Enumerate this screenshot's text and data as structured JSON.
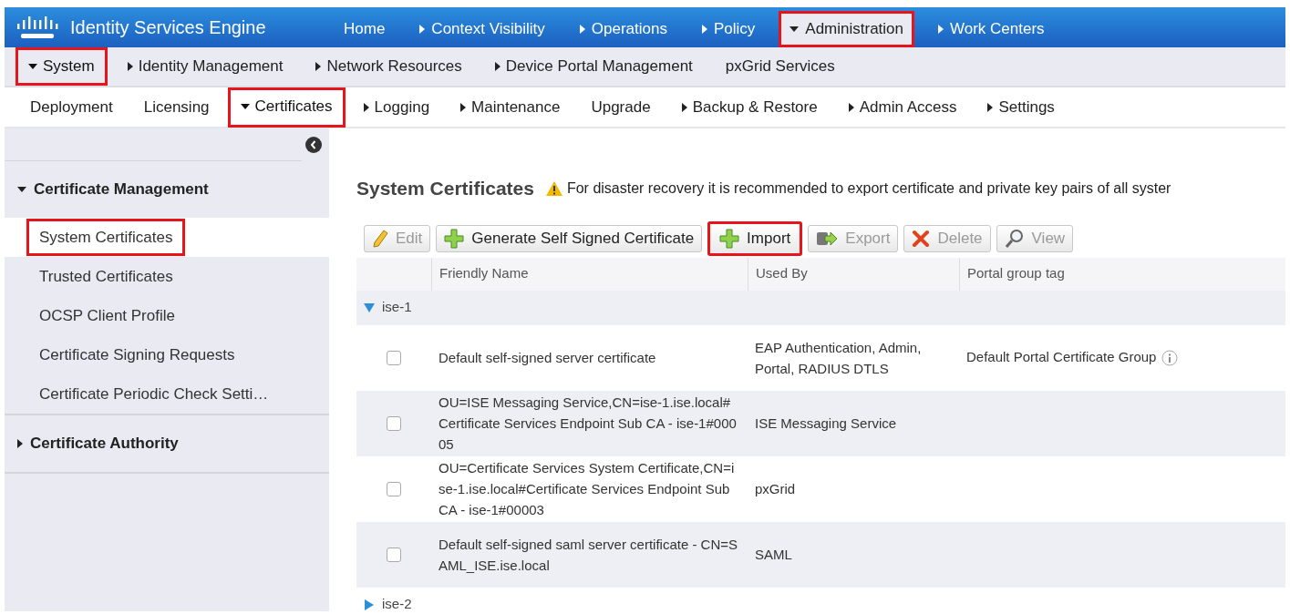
{
  "app": {
    "title": "Identity Services Engine"
  },
  "top_nav": [
    {
      "label": "Home",
      "selected": false,
      "highlighted": false
    },
    {
      "label": "Context Visibility",
      "expanded": false,
      "selected": false,
      "highlighted": false
    },
    {
      "label": "Operations",
      "expanded": false,
      "selected": false,
      "highlighted": false
    },
    {
      "label": "Policy",
      "expanded": false,
      "selected": false,
      "highlighted": false
    },
    {
      "label": "Administration",
      "expanded": true,
      "selected": true,
      "highlighted": true
    },
    {
      "label": "Work Centers",
      "expanded": false,
      "selected": false,
      "highlighted": false
    }
  ],
  "second_nav": [
    {
      "label": "System",
      "expanded": true,
      "selected": true,
      "highlighted": true
    },
    {
      "label": "Identity Management",
      "expanded": false,
      "selected": false,
      "highlighted": false
    },
    {
      "label": "Network Resources",
      "expanded": false,
      "selected": false,
      "highlighted": false
    },
    {
      "label": "Device Portal Management",
      "expanded": false,
      "selected": false,
      "highlighted": false
    },
    {
      "label": "pxGrid Services",
      "selected": false,
      "highlighted": false
    }
  ],
  "third_nav": [
    {
      "label": "Deployment",
      "selected": false,
      "highlighted": false
    },
    {
      "label": "Licensing",
      "selected": false,
      "highlighted": false
    },
    {
      "label": "Certificates",
      "expanded": true,
      "selected": true,
      "highlighted": true
    },
    {
      "label": "Logging",
      "expanded": false,
      "selected": false,
      "highlighted": false
    },
    {
      "label": "Maintenance",
      "expanded": false,
      "selected": false,
      "highlighted": false
    },
    {
      "label": "Upgrade",
      "selected": false,
      "highlighted": false
    },
    {
      "label": "Backup & Restore",
      "expanded": false,
      "selected": false,
      "highlighted": false
    },
    {
      "label": "Admin Access",
      "expanded": false,
      "selected": false,
      "highlighted": false
    },
    {
      "label": "Settings",
      "expanded": false,
      "selected": false,
      "highlighted": false
    }
  ],
  "sidebar": {
    "sections": [
      {
        "label": "Certificate Management",
        "expanded": true,
        "items": [
          {
            "label": "System Certificates",
            "selected": true,
            "highlighted": true
          },
          {
            "label": "Trusted Certificates",
            "selected": false,
            "highlighted": false
          },
          {
            "label": "OCSP Client Profile",
            "selected": false,
            "highlighted": false
          },
          {
            "label": "Certificate Signing Requests",
            "selected": false,
            "highlighted": false
          },
          {
            "label": "Certificate Periodic Check Setti…",
            "selected": false,
            "highlighted": false
          }
        ]
      },
      {
        "label": "Certificate Authority",
        "expanded": false
      }
    ]
  },
  "page": {
    "title": "System Certificates",
    "warning": "For disaster recovery it is recommended to export certificate and private key pairs of all syster"
  },
  "toolbar": [
    {
      "label": "Edit",
      "kind": "edit",
      "disabled": true,
      "highlighted": false
    },
    {
      "label": "Generate Self Signed Certificate",
      "kind": "add",
      "disabled": false,
      "highlighted": false
    },
    {
      "label": "Import",
      "kind": "add",
      "disabled": false,
      "highlighted": true
    },
    {
      "label": "Export",
      "kind": "export",
      "disabled": true,
      "highlighted": false
    },
    {
      "label": "Delete",
      "kind": "delete",
      "disabled": true,
      "highlighted": false
    },
    {
      "label": "View",
      "kind": "view",
      "disabled": true,
      "highlighted": false
    }
  ],
  "table": {
    "columns": [
      "Friendly Name",
      "Used By",
      "Portal group tag"
    ],
    "groups": [
      {
        "label": "ise-1",
        "expanded": true,
        "rows": [
          {
            "checked": false,
            "friendly_name": "Default self-signed server certificate",
            "used_by": "EAP Authentication, Admin, Portal, RADIUS DTLS",
            "portal_group_tag": "Default Portal Certificate Group",
            "info": true
          },
          {
            "checked": false,
            "friendly_name": "OU=ISE Messaging Service,CN=ise-1.ise.local#Certificate Services Endpoint Sub CA - ise-1#00005",
            "used_by": "ISE Messaging Service"
          },
          {
            "checked": false,
            "friendly_name": "OU=Certificate Services System Certificate,CN=ise-1.ise.local#Certificate Services Endpoint Sub CA - ise-1#00003",
            "used_by": "pxGrid"
          },
          {
            "checked": false,
            "friendly_name": "Default self-signed saml server certificate - CN=SAML_ISE.ise.local",
            "used_by": "SAML"
          }
        ]
      },
      {
        "label": "ise-2",
        "expanded": false
      }
    ]
  }
}
